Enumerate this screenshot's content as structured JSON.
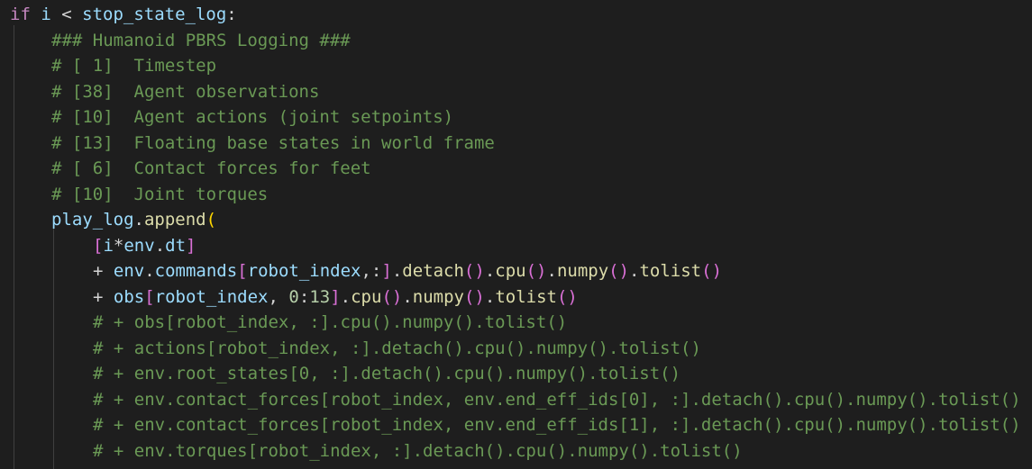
{
  "editor": {
    "theme": "dark",
    "colors": {
      "background": "#1e1e1e",
      "keyword": "#c586c0",
      "variable": "#9cdcfe",
      "function": "#dcdcaa",
      "operator": "#d4d4d4",
      "number": "#b5cea8",
      "bracket_level1": "#ffd700",
      "bracket_level2": "#da70d6",
      "bracket_level3": "#179fff",
      "comment": "#6a9955"
    },
    "lines": [
      {
        "tokens": [
          {
            "t": "if",
            "c": "kw"
          },
          {
            "t": " ",
            "c": "op"
          },
          {
            "t": "i",
            "c": "var"
          },
          {
            "t": " < ",
            "c": "op"
          },
          {
            "t": "stop_state_log",
            "c": "var"
          },
          {
            "t": ":",
            "c": "op"
          }
        ]
      },
      {
        "tokens": [
          {
            "t": "### Humanoid PBRS Logging ###",
            "c": "cm"
          }
        ]
      },
      {
        "tokens": [
          {
            "t": "# [ 1]  Timestep",
            "c": "cm"
          }
        ]
      },
      {
        "tokens": [
          {
            "t": "# [38]  Agent observations",
            "c": "cm"
          }
        ]
      },
      {
        "tokens": [
          {
            "t": "# [10]  Agent actions (joint setpoints)",
            "c": "cm"
          }
        ]
      },
      {
        "tokens": [
          {
            "t": "# [13]  Floating base states in world frame",
            "c": "cm"
          }
        ]
      },
      {
        "tokens": [
          {
            "t": "# [ 6]  Contact forces for feet",
            "c": "cm"
          }
        ]
      },
      {
        "tokens": [
          {
            "t": "# [10]  Joint torques",
            "c": "cm"
          }
        ]
      },
      {
        "tokens": [
          {
            "t": "play_log",
            "c": "var"
          },
          {
            "t": ".",
            "c": "op"
          },
          {
            "t": "append",
            "c": "fn"
          },
          {
            "t": "(",
            "c": "p1"
          }
        ]
      },
      {
        "tokens": [
          {
            "t": "[",
            "c": "p2"
          },
          {
            "t": "i",
            "c": "var"
          },
          {
            "t": "*",
            "c": "op"
          },
          {
            "t": "env",
            "c": "var"
          },
          {
            "t": ".",
            "c": "op"
          },
          {
            "t": "dt",
            "c": "var"
          },
          {
            "t": "]",
            "c": "p2"
          }
        ]
      },
      {
        "tokens": [
          {
            "t": "+ ",
            "c": "op"
          },
          {
            "t": "env",
            "c": "var"
          },
          {
            "t": ".",
            "c": "op"
          },
          {
            "t": "commands",
            "c": "var"
          },
          {
            "t": "[",
            "c": "p2"
          },
          {
            "t": "robot_index",
            "c": "var"
          },
          {
            "t": ",:",
            "c": "op"
          },
          {
            "t": "]",
            "c": "p2"
          },
          {
            "t": ".",
            "c": "op"
          },
          {
            "t": "detach",
            "c": "fn"
          },
          {
            "t": "()",
            "c": "p2"
          },
          {
            "t": ".",
            "c": "op"
          },
          {
            "t": "cpu",
            "c": "fn"
          },
          {
            "t": "()",
            "c": "p2"
          },
          {
            "t": ".",
            "c": "op"
          },
          {
            "t": "numpy",
            "c": "fn"
          },
          {
            "t": "()",
            "c": "p2"
          },
          {
            "t": ".",
            "c": "op"
          },
          {
            "t": "tolist",
            "c": "fn"
          },
          {
            "t": "()",
            "c": "p2"
          }
        ]
      },
      {
        "tokens": [
          {
            "t": "+ ",
            "c": "op"
          },
          {
            "t": "obs",
            "c": "var"
          },
          {
            "t": "[",
            "c": "p2"
          },
          {
            "t": "robot_index",
            "c": "var"
          },
          {
            "t": ", ",
            "c": "op"
          },
          {
            "t": "0",
            "c": "num"
          },
          {
            "t": ":",
            "c": "op"
          },
          {
            "t": "13",
            "c": "num"
          },
          {
            "t": "]",
            "c": "p2"
          },
          {
            "t": ".",
            "c": "op"
          },
          {
            "t": "cpu",
            "c": "fn"
          },
          {
            "t": "()",
            "c": "p2"
          },
          {
            "t": ".",
            "c": "op"
          },
          {
            "t": "numpy",
            "c": "fn"
          },
          {
            "t": "()",
            "c": "p2"
          },
          {
            "t": ".",
            "c": "op"
          },
          {
            "t": "tolist",
            "c": "fn"
          },
          {
            "t": "()",
            "c": "p2"
          }
        ]
      },
      {
        "tokens": [
          {
            "t": "# + obs[robot_index, :].cpu().numpy().tolist()",
            "c": "cm"
          }
        ]
      },
      {
        "tokens": [
          {
            "t": "# + actions[robot_index, :].detach().cpu().numpy().tolist()",
            "c": "cm"
          }
        ]
      },
      {
        "tokens": [
          {
            "t": "# + env.root_states[0, :].detach().cpu().numpy().tolist()",
            "c": "cm"
          }
        ]
      },
      {
        "tokens": [
          {
            "t": "# + env.contact_forces[robot_index, env.end_eff_ids[0], :].detach().cpu().numpy().tolist()",
            "c": "cm"
          }
        ]
      },
      {
        "tokens": [
          {
            "t": "# + env.contact_forces[robot_index, env.end_eff_ids[1], :].detach().cpu().numpy().tolist()",
            "c": "cm"
          }
        ]
      },
      {
        "tokens": [
          {
            "t": "# + env.torques[robot_index, :].detach().cpu().numpy().tolist()",
            "c": "cm"
          }
        ]
      }
    ]
  }
}
